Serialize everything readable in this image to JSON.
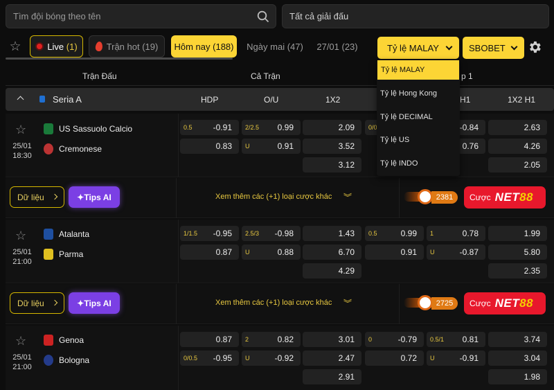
{
  "search": {
    "placeholder": "Tìm đội bóng theo tên"
  },
  "league_filter": {
    "value": "Tất cả giải đấu"
  },
  "tabs": [
    {
      "label": "Live",
      "count": "(1)"
    },
    {
      "label": "Trận hot",
      "count": "(19)"
    },
    {
      "label": "Hôm nay (188)"
    },
    {
      "label": "Ngày mai (47)"
    },
    {
      "label": "27/01 (23)"
    }
  ],
  "odds_type": {
    "value": "Tỷ lệ MALAY"
  },
  "bookmaker": {
    "value": "SBOBET"
  },
  "dropdown": {
    "options": [
      "Tỷ lệ MALAY",
      "Tỷ lệ Hong Kong",
      "Tỷ lệ DECIMAL",
      "Tỷ lệ US",
      "Tỷ lệ INDO"
    ]
  },
  "header": {
    "match_col": "Trận Đấu",
    "full_match": "Cả Trận",
    "half_partial": "p 1"
  },
  "league": {
    "name": "Seria A",
    "cols": [
      "HDP",
      "O/U",
      "1X2",
      "H1",
      "1X2 H1"
    ]
  },
  "matches": [
    {
      "date": "25/01",
      "time": "18:30",
      "home": "US Sassuolo Calcio",
      "away": "Cremonese",
      "hdp": {
        "line": "0.5",
        "home": "-0.91",
        "away": "0.83"
      },
      "ou": {
        "line": "2/2.5",
        "over": "0.99",
        "under_lab": "U",
        "under": "0.91"
      },
      "x12": [
        "2.09",
        "3.52",
        "3.12"
      ],
      "hdp_h1": {
        "line": "0/0",
        "home": "",
        "away": ""
      },
      "ou_h1": {
        "line": "",
        "over": "-0.84",
        "under": "0.76"
      },
      "x12_h1": [
        "2.63",
        "4.26",
        "2.05"
      ],
      "more": "Xem thêm các (+1) loại cược khác",
      "fire_count": "2381"
    },
    {
      "date": "25/01",
      "time": "21:00",
      "home": "Atalanta",
      "away": "Parma",
      "hdp": {
        "line": "1/1.5",
        "home": "-0.95",
        "away": "0.87"
      },
      "ou": {
        "line": "2.5/3",
        "over": "-0.98",
        "under_lab": "U",
        "under": "0.88"
      },
      "x12": [
        "1.43",
        "6.70",
        "4.29"
      ],
      "hdp_h1": {
        "line": "0.5",
        "home": "0.99",
        "away": "0.91"
      },
      "ou_h1": {
        "line": "1",
        "over": "0.78",
        "under_lab": "U",
        "under": "-0.87"
      },
      "x12_h1": [
        "1.99",
        "5.80",
        "2.35"
      ],
      "more": "Xem thêm các (+1) loại cược khác",
      "fire_count": "2725"
    },
    {
      "date": "25/01",
      "time": "21:00",
      "home": "Genoa",
      "away": "Bologna",
      "hdp": {
        "line": "",
        "home": "0.87",
        "away_line": "0/0.5",
        "away": "-0.95"
      },
      "ou": {
        "line": "2",
        "over": "0.82",
        "under_lab": "U",
        "under": "-0.92"
      },
      "x12": [
        "3.01",
        "2.47",
        "2.91"
      ],
      "hdp_h1": {
        "line": "0",
        "home": "-0.79",
        "away": "0.72"
      },
      "ou_h1": {
        "line": "0.5/1",
        "over": "0.81",
        "under_lab": "U",
        "under": "-0.91"
      },
      "x12_h1": [
        "3.74",
        "3.04",
        "1.98"
      ]
    }
  ],
  "buttons": {
    "data": "Dữ liệu",
    "tips": "Tips AI",
    "bet_prefix": "Cược",
    "bet_brand": "NET",
    "bet_brand2": "88"
  }
}
